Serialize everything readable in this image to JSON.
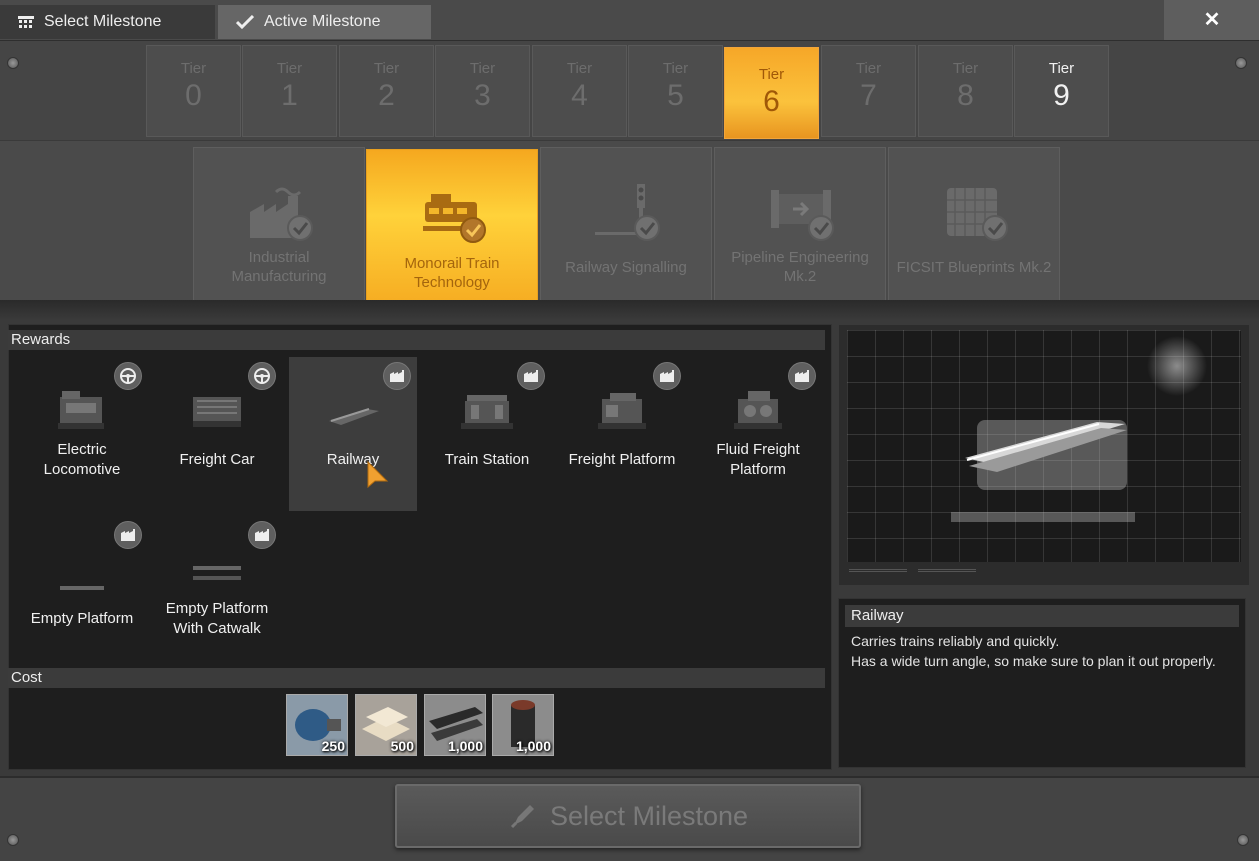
{
  "tabs": {
    "select_milestone": "Select Milestone",
    "active_milestone": "Active Milestone"
  },
  "close_label": "✕",
  "tiers": [
    {
      "label": "Tier",
      "number": "0"
    },
    {
      "label": "Tier",
      "number": "1"
    },
    {
      "label": "Tier",
      "number": "2"
    },
    {
      "label": "Tier",
      "number": "3"
    },
    {
      "label": "Tier",
      "number": "4"
    },
    {
      "label": "Tier",
      "number": "5"
    },
    {
      "label": "Tier",
      "number": "6"
    },
    {
      "label": "Tier",
      "number": "7"
    },
    {
      "label": "Tier",
      "number": "8"
    },
    {
      "label": "Tier",
      "number": "9"
    }
  ],
  "selected_tier": "6",
  "milestones": [
    {
      "name": "Industrial\nManufacturing",
      "icon": "factory-icon",
      "completed": true
    },
    {
      "name": "Monorail Train\nTechnology",
      "icon": "train-icon",
      "completed": true
    },
    {
      "name": "Railway Signalling",
      "icon": "signal-icon",
      "completed": true
    },
    {
      "name": "Pipeline Engineering\nMk.2",
      "icon": "pipeline-icon",
      "completed": true
    },
    {
      "name": "FICSIT Blueprints Mk.2",
      "icon": "blueprint-icon",
      "completed": true
    }
  ],
  "rewards_header": "Rewards",
  "rewards": [
    {
      "name": "Electric\nLocomotive",
      "badge": "vehicle-icon"
    },
    {
      "name": "Freight Car",
      "badge": "vehicle-icon"
    },
    {
      "name": "Railway",
      "badge": "building-icon"
    },
    {
      "name": "Train Station",
      "badge": "building-icon"
    },
    {
      "name": "Freight Platform",
      "badge": "building-icon"
    },
    {
      "name": "Fluid Freight\nPlatform",
      "badge": "building-icon"
    },
    {
      "name": "Empty Platform",
      "badge": "building-icon"
    },
    {
      "name": "Empty Platform\nWith Catwalk",
      "badge": "building-icon"
    }
  ],
  "cost_header": "Cost",
  "costs": [
    {
      "amount": "250",
      "icon": "motor-icon"
    },
    {
      "amount": "500",
      "icon": "concrete-icon"
    },
    {
      "amount": "1,000",
      "icon": "steel-beam-icon"
    },
    {
      "amount": "1,000",
      "icon": "steel-pipe-icon"
    }
  ],
  "detail": {
    "title": "Railway",
    "description": "Carries trains reliably and quickly.\nHas a wide turn angle, so make sure to plan it out properly."
  },
  "select_button_label": "Select Milestone",
  "colors": {
    "accent": "#f7a928",
    "panel": "#1e1e1e"
  }
}
